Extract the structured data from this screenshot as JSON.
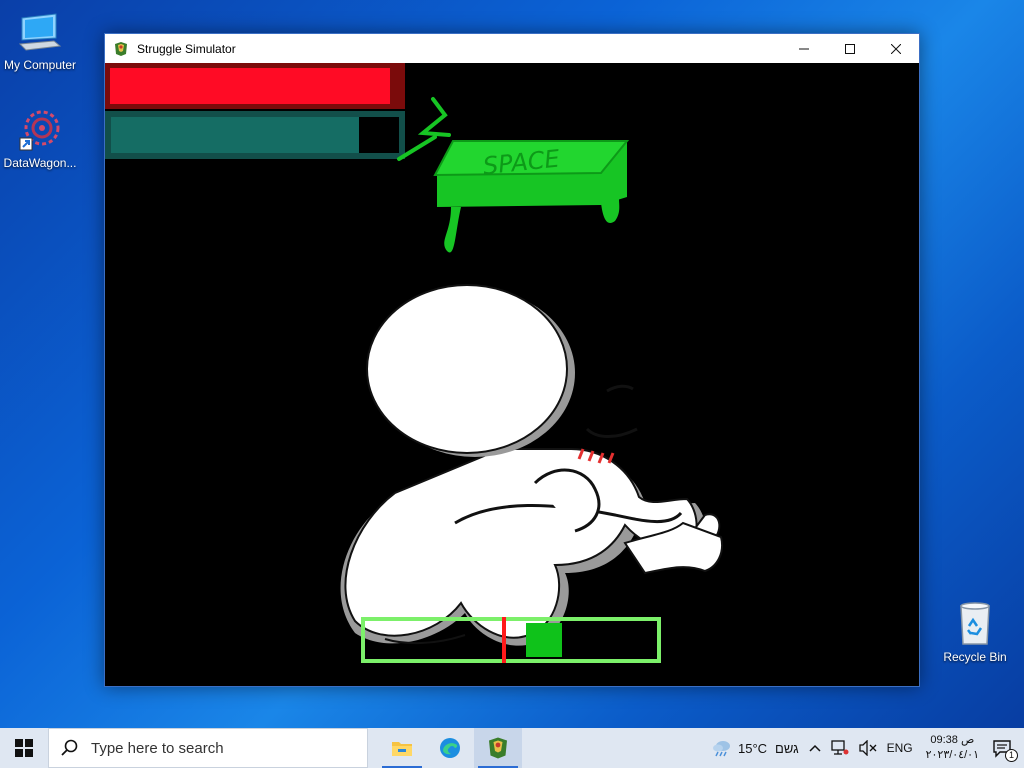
{
  "desktop": {
    "icons": [
      {
        "label": "My Computer"
      },
      {
        "label": "DataWagon..."
      },
      {
        "label": "Recycle Bin"
      }
    ]
  },
  "window": {
    "title": "Struggle Simulator",
    "controls": {
      "minimize": "—",
      "maximize": "☐",
      "close": "✕"
    }
  },
  "game": {
    "health_fraction": 0.965,
    "stamina_fraction": 0.86,
    "prompt_key_text": "SPACE",
    "qte": {
      "target_start_fraction": 0.55,
      "target_end_fraction": 0.675,
      "cursor_fraction": 0.47
    },
    "colors": {
      "health": "#ff0b25",
      "stamina": "#156d64",
      "qte_border": "#7cf06a",
      "qte_target": "#0fc21a",
      "qte_cursor": "#ff1a1a",
      "space_key": "#17c524"
    }
  },
  "taskbar": {
    "search_placeholder": "Type here to search",
    "apps": [
      "file-explorer-icon",
      "edge-icon",
      "struggle-simulator-icon"
    ],
    "weather": {
      "temp": "15°C",
      "condition": "גשם"
    },
    "language": "ENG",
    "clock": {
      "time": "09:38 ص",
      "date": "٢٠٢٣/٠٤/٠١"
    },
    "notification_count": "1"
  }
}
